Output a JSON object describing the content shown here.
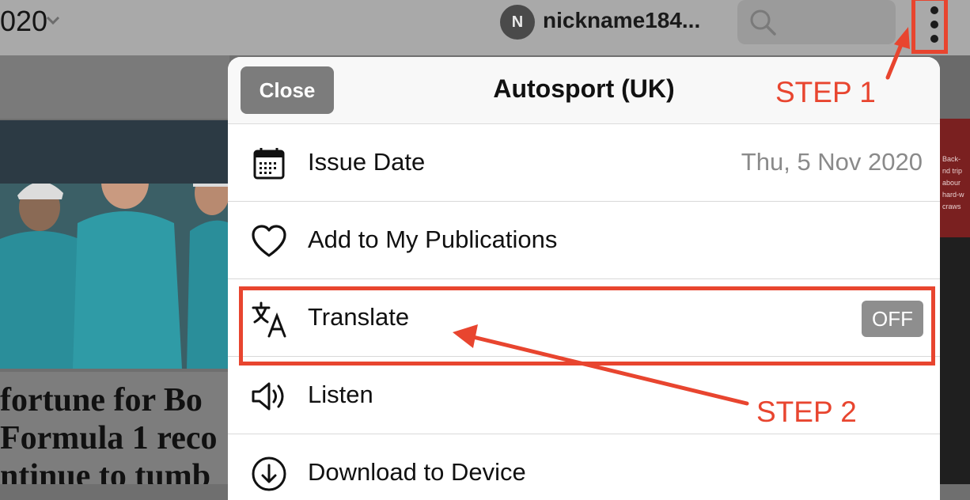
{
  "topbar": {
    "year_fragment": "020",
    "avatar_initial": "N",
    "username": "nickname184...",
    "icons": {
      "year_dropdown": "chevron-down-icon",
      "search": "search-icon",
      "more": "more-vertical-icon"
    }
  },
  "background_article": {
    "headline_lines": [
      "fortune for Bo",
      "Formula 1 reco",
      "ntinue to tumb"
    ],
    "right_ad_lines": [
      "Back-",
      "nd trip",
      "abour",
      "hard-w",
      "craws"
    ]
  },
  "sheet": {
    "close_label": "Close",
    "title": "Autosport (UK)",
    "rows": [
      {
        "label": "Issue Date",
        "value": "Thu, 5 Nov 2020",
        "icon": "calendar-icon"
      },
      {
        "label": "Add to My Publications",
        "icon": "heart-icon"
      },
      {
        "label": "Translate",
        "toggle": "OFF",
        "icon": "translate-icon"
      },
      {
        "label": "Listen",
        "icon": "speaker-icon"
      },
      {
        "label": "Download to Device",
        "icon": "download-icon"
      }
    ]
  },
  "annotations": {
    "step1": "STEP 1",
    "step2": "STEP 2",
    "color": "#e8452f"
  },
  "colors": {
    "overlay_gray": "#a9a9a9",
    "sheet_bg": "#ffffff",
    "button_gray": "#7c7c7c"
  }
}
